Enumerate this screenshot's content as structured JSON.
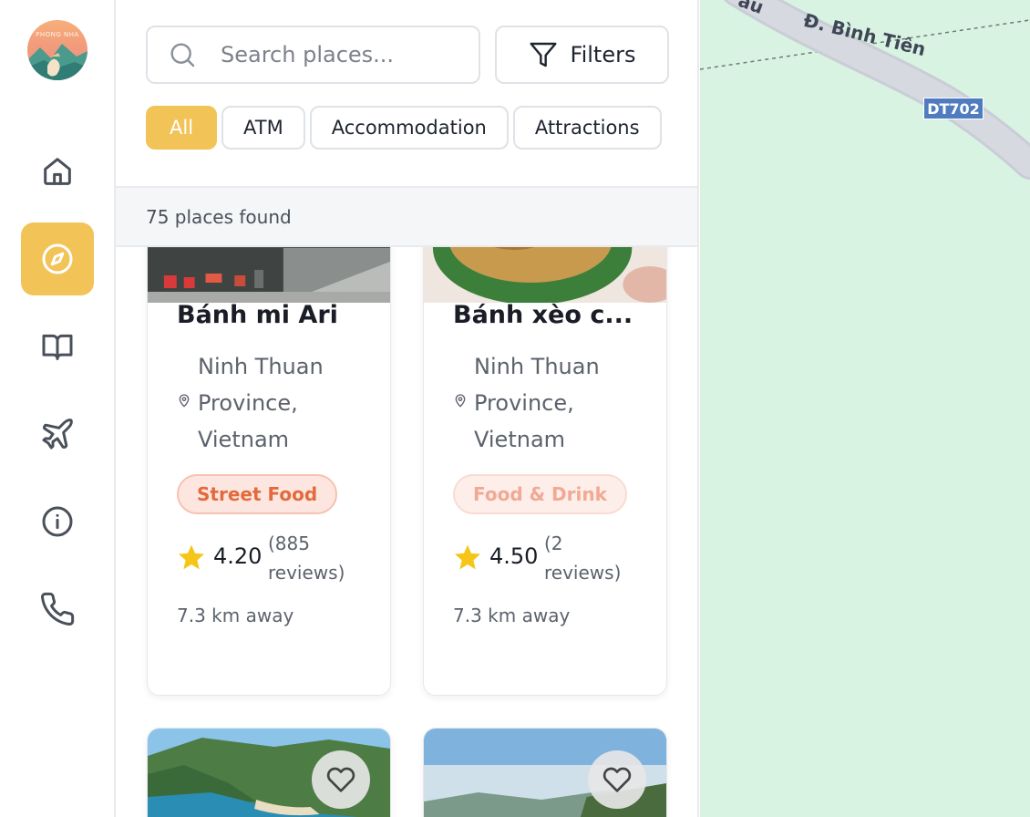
{
  "logo": {
    "text": "PHONG NHA",
    "colors": {
      "sky": "#f6b07a",
      "mountain": "#4a9a8e",
      "accent": "#f2c357"
    }
  },
  "sidebar": {
    "items": [
      {
        "icon": "home-icon",
        "active": false
      },
      {
        "icon": "compass-icon",
        "active": true
      },
      {
        "icon": "book-icon",
        "active": false
      },
      {
        "icon": "plane-icon",
        "active": false
      },
      {
        "icon": "info-icon",
        "active": false
      },
      {
        "icon": "phone-icon",
        "active": false
      }
    ],
    "active_color": "#f2c357"
  },
  "search": {
    "placeholder": "Search places...",
    "value": ""
  },
  "filters": {
    "label": "Filters"
  },
  "categories": {
    "items": [
      "All",
      "ATM",
      "Accommodation",
      "Attractions"
    ],
    "selected": "All"
  },
  "results": {
    "count_text": "75 places found"
  },
  "cards": [
    {
      "title": "Bánh mi Ari",
      "location": "Ninh Thuan Province, Vietnam",
      "tag": "Street Food",
      "rating": "4.20",
      "reviews": "(885 reviews)",
      "distance": "7.3 km away"
    },
    {
      "title": "Bánh xèo c...",
      "location": "Ninh Thuan Province, Vietnam",
      "tag": "Food & Drink",
      "rating": "4.50",
      "reviews": "(2 reviews)",
      "distance": "7.3 km away"
    }
  ],
  "map": {
    "road_name": "Đ. Bình Tiên",
    "road_name_partial": "au",
    "route_shield": "DT702",
    "colors": {
      "land": "#d9f3e2",
      "road": "#c9cdd6",
      "shield": "#4f7cc0"
    }
  }
}
